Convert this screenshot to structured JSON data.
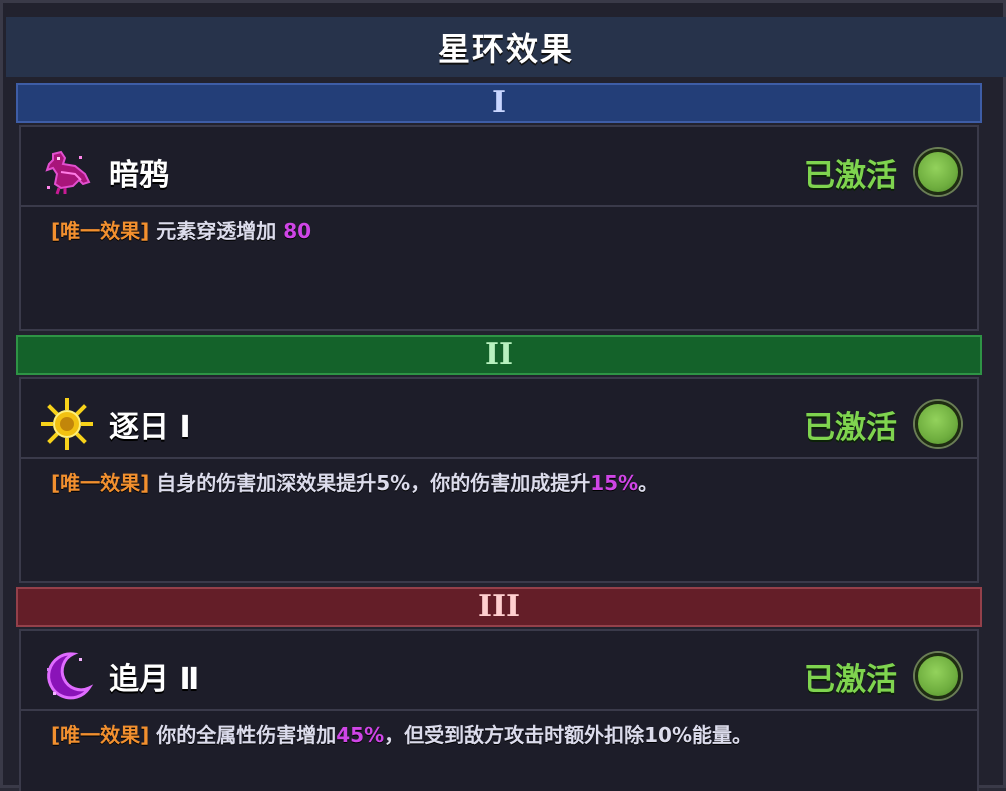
{
  "title": "星环效果",
  "tiers": [
    {
      "numeral": "I",
      "effect": {
        "name": "暗鸦",
        "icon": "raven-icon",
        "status": "已激活",
        "tag": "[唯一效果]",
        "desc_before": "元素穿透增加",
        "desc_value": "80",
        "desc_after": ""
      }
    },
    {
      "numeral": "II",
      "effect": {
        "name": "逐日 Ⅰ",
        "icon": "sun-icon",
        "status": "已激活",
        "tag": "[唯一效果]",
        "desc_before": "自身的伤害加深效果提升5%，你的伤害加成提升",
        "desc_value": "15%",
        "desc_after": "。"
      }
    },
    {
      "numeral": "III",
      "effect": {
        "name": "追月 Ⅱ",
        "icon": "crescent-moon-icon",
        "status": "已激活",
        "tag": "[唯一效果]",
        "desc_before": "你的全属性伤害增加",
        "desc_value": "45%",
        "desc_after": "，但受到敌方攻击时额外扣除10%能量。"
      }
    }
  ],
  "colors": {
    "tier_1": "#233e78",
    "tier_2": "#14622a",
    "tier_3": "#641e28",
    "status_active": "#7fd44f",
    "tag": "#f2902f",
    "highlight": "#cf45e6"
  }
}
